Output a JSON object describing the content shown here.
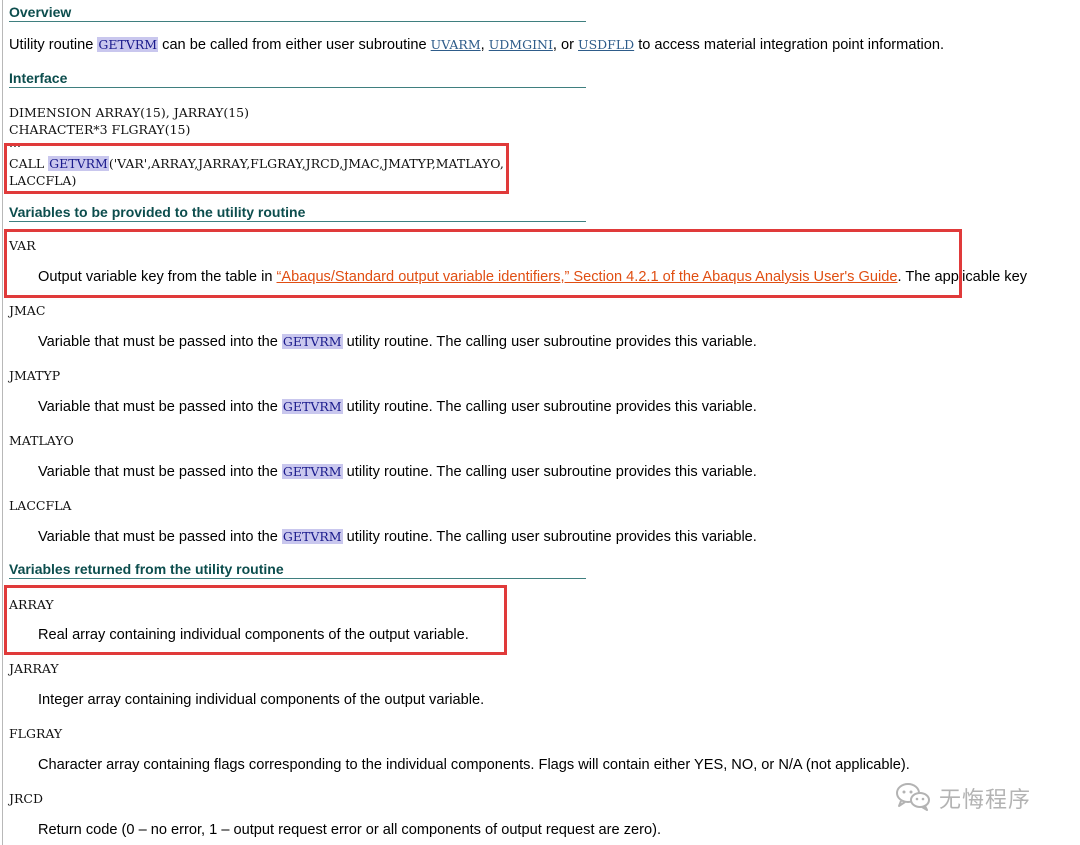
{
  "overview": {
    "heading": "Overview",
    "text_before": "Utility routine ",
    "routine": "GETVRM",
    "text_middle": " can be called from either user subroutine ",
    "link1": "UVARM",
    "sep1": ", ",
    "link2": "UDMGINI",
    "sep2": ", or ",
    "link3": "USDFLD",
    "text_after": " to access material integration point information."
  },
  "interface": {
    "heading": "Interface",
    "line1": "DIMENSION ARRAY(15),  JARRAY(15)",
    "line2": "CHARACTER*3 FLGRAY(15)",
    "line3": "...",
    "call_prefix": "CALL ",
    "call_routine": "GETVRM",
    "call_args": "('VAR',ARRAY,JARRAY,FLGRAY,JRCD,JMAC,JMATYP,MATLAYO,",
    "call_cont": "LACCFLA)"
  },
  "provided": {
    "heading": "Variables to be provided to the utility routine",
    "items": [
      {
        "name": "VAR",
        "desc_before": "Output variable key from the table in ",
        "link_text": "“Abaqus/Standard output variable identifiers,”  Section 4.2.1 of the Abaqus Analysis User's Guide",
        "desc_after": ". The applicable key"
      },
      {
        "name": "JMAC",
        "desc_before": "Variable that must be passed into the ",
        "routine": "GETVRM",
        "desc_after": " utility routine. The calling user subroutine provides this variable."
      },
      {
        "name": "JMATYP",
        "desc_before": "Variable that must be passed into the ",
        "routine": "GETVRM",
        "desc_after": " utility routine. The calling user subroutine provides this variable."
      },
      {
        "name": "MATLAYO",
        "desc_before": "Variable that must be passed into the ",
        "routine": "GETVRM",
        "desc_after": " utility routine. The calling user subroutine provides this variable."
      },
      {
        "name": "LACCFLA",
        "desc_before": "Variable that must be passed into the ",
        "routine": "GETVRM",
        "desc_after": " utility routine. The calling user subroutine provides this variable."
      }
    ]
  },
  "returned": {
    "heading": "Variables returned from the utility routine",
    "items": [
      {
        "name": "ARRAY",
        "desc": "Real array containing individual components of the output variable."
      },
      {
        "name": "JARRAY",
        "desc": "Integer array containing individual components of the output variable."
      },
      {
        "name": "FLGRAY",
        "desc": "Character array containing flags corresponding to the individual components. Flags will contain either YES, NO, or N/A (not applicable)."
      },
      {
        "name": "JRCD",
        "desc": "Return code (0 – no error, 1 – output request error or all components of output request are zero)."
      }
    ]
  },
  "watermark": {
    "icon": "wechat-icon",
    "text": "无悔程序"
  },
  "colors": {
    "heading": "#0c4d4d",
    "highlight_bg": "#c9c7ee",
    "link_orange": "#e04e12",
    "annotation_red": "#e03a3a"
  }
}
